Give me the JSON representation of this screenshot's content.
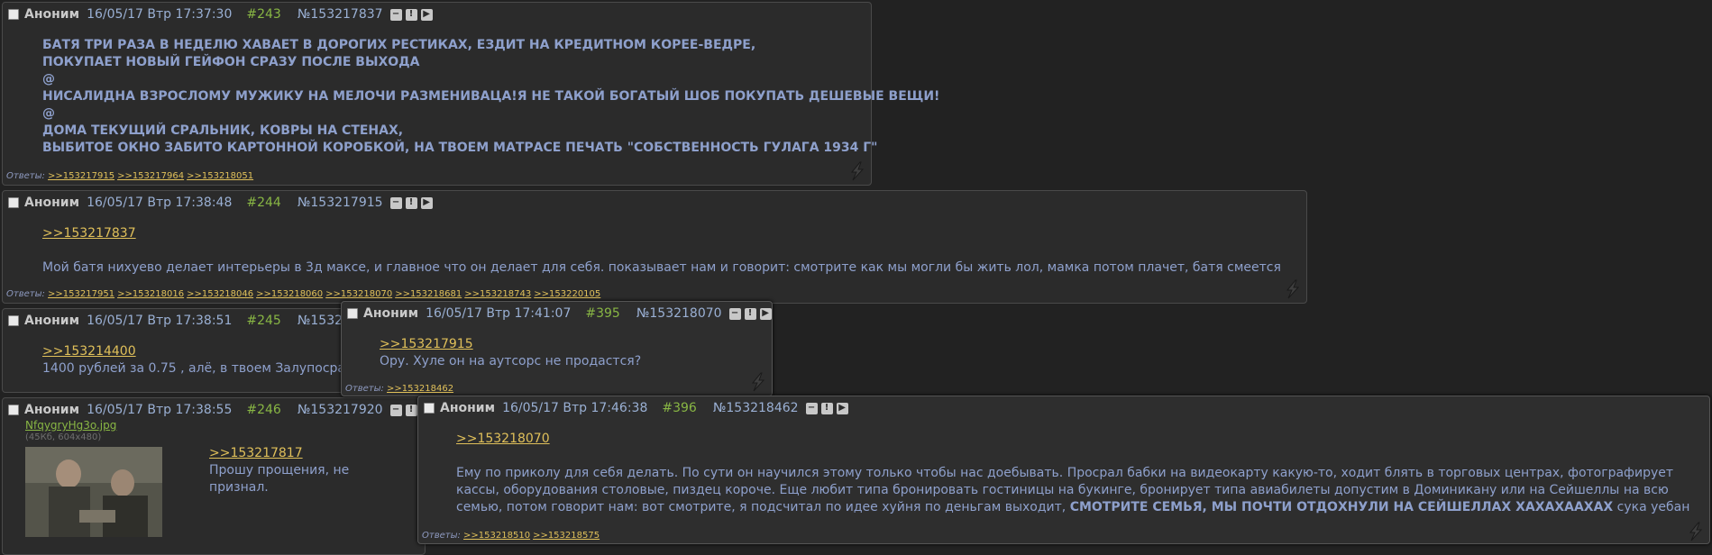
{
  "common": {
    "author": "Аноним",
    "replies_label": "Ответы:"
  },
  "post243": {
    "date": "16/05/17 Втр 17:37:30",
    "num": "#243",
    "id": "№153217837",
    "lines": [
      "БАТЯ ТРИ РАЗА В НЕДЕЛЮ ХАВАЕТ В ДОРОГИХ РЕСТИКАХ, ЕЗДИТ НА КРЕДИТНОМ КОРЕЕ-ВЕДРЕ,",
      "ПОКУПАЕТ НОВЫЙ ГЕЙФОН СРАЗУ ПОСЛЕ ВЫХОДА",
      "@",
      "НИСАЛИДНА ВЗРОСЛОМУ МУЖИКУ НА МЕЛОЧИ РАЗМЕНИВАЦА!Я НЕ ТАКОЙ БОГАТЫЙ ШОБ ПОКУПАТЬ ДЕШЕВЫЕ ВЕЩИ!",
      "@",
      "ДОМА ТЕКУЩИЙ СРАЛЬНИК, КОВРЫ НА СТЕНАХ,",
      "ВЫБИТОЕ ОКНО ЗАБИТО КАРТОННОЙ КОРОБКОЙ, НА ТВОЕМ МАТРАСЕ ПЕЧАТЬ \"СОБСТВЕННОСТЬ ГУЛАГА 1934 Г\""
    ],
    "replies": [
      ">>153217915",
      ">>153217964",
      ">>153218051"
    ]
  },
  "post244": {
    "date": "16/05/17 Втр 17:38:48",
    "num": "#244",
    "id": "№153217915",
    "quote": ">>153217837",
    "text": "Мой батя нихуево делает интерьеры в 3д максе, и главное что он делает для себя. показывает нам и говорит: смотрите как мы могли бы жить лол, мамка потом плачет, батя смеется",
    "replies": [
      ">>153217951",
      ">>153218016",
      ">>153218046",
      ">>153218060",
      ">>153218070",
      ">>153218681",
      ">>153218743",
      ">>153220105"
    ]
  },
  "post245": {
    "date": "16/05/17 Втр 17:38:51",
    "num": "#245",
    "id_partial": "№15321",
    "quote": ">>153214400",
    "text_partial": "1400 рублей за 0.75 , алё, в твоем Залупоcра"
  },
  "post246": {
    "date": "16/05/17 Втр 17:38:55",
    "num": "#246",
    "id": "№153217920",
    "file_name": "NfqygryHg3o.jpg",
    "file_meta": "(45Кб, 604x480)",
    "quote": ">>153217817",
    "lines": [
      "Прошу прощения, не",
      "признал."
    ]
  },
  "post395": {
    "date": "16/05/17 Втр 17:41:07",
    "num": "#395",
    "id": "№153218070",
    "quote": ">>153217915",
    "text": "Ору. Хуле он на аутсорс не продастся?",
    "replies": [
      ">>153218462"
    ]
  },
  "post396": {
    "date": "16/05/17 Втр 17:46:38",
    "num": "#396",
    "id": "№153218462",
    "quote": ">>153218070",
    "line1": "Ему по приколу для себя делать. По сути он научился этому только чтобы нас доебывать. Просрал бабки на видеокарту какую-то, ходит блять в торговых центрах, фотографирует",
    "line2": "кассы, оборудования столовые, пиздец короче. Еще любит типа бронировать гостиницы на букинге, бронирует типа авиабилеты допустим в Доминикану или на Сейшеллы на всю",
    "line3_start": "семью, потом говорит нам: вот смотрите, я подсчитал по идее хуйня по деньгам выходит, ",
    "line3_caps": "СМОТРИТЕ СЕМЬЯ, МЫ ПОЧТИ ОТДОХНУЛИ НА СЕЙШЕЛЛАХ ХАХАХААХАХ",
    "line3_end": " сука уебан",
    "replies": [
      ">>153218510",
      ">>153218575"
    ]
  },
  "icons": {
    "hide": "minus-icon",
    "report": "exclamation-icon",
    "menu": "play-icon",
    "bolt": "lightning-icon"
  }
}
